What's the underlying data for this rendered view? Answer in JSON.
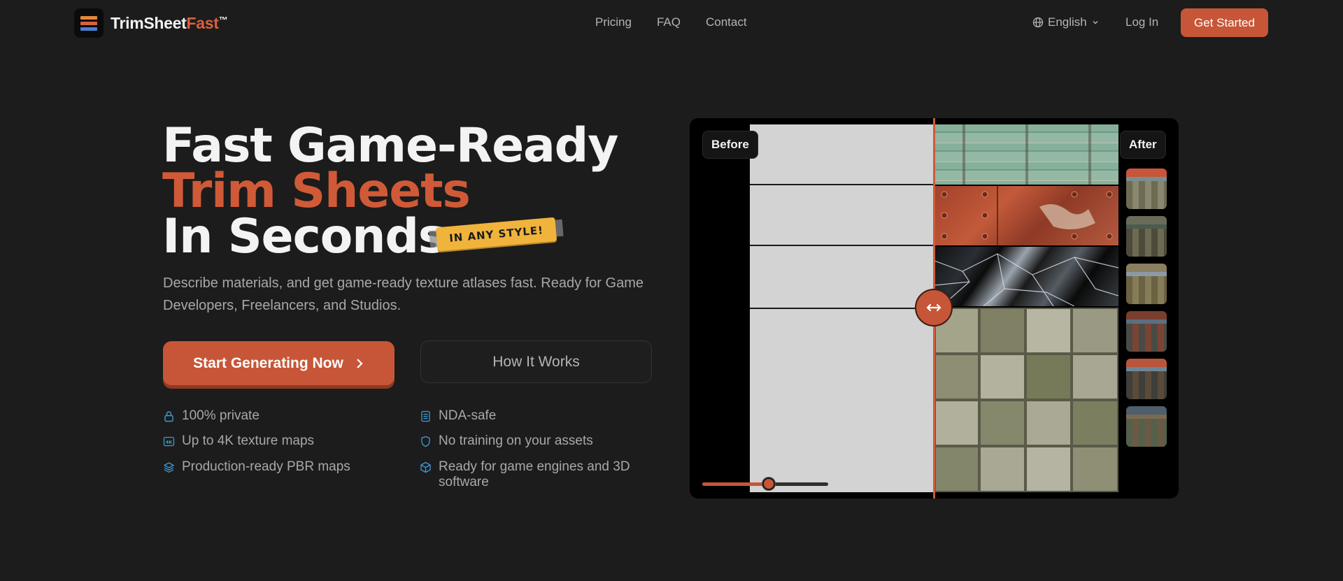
{
  "brand": {
    "name_main": "TrimSheet",
    "name_accent": "Fast",
    "trademark": "™",
    "logo_colors": [
      "#e5883c",
      "#d9603b",
      "#4a7fd0"
    ]
  },
  "nav": {
    "links": [
      "Pricing",
      "FAQ",
      "Contact"
    ],
    "language": "English",
    "login": "Log In",
    "cta": "Get Started"
  },
  "hero": {
    "title_line1": "Fast Game-Ready",
    "title_line2": "Trim Sheets",
    "title_line3": "In Seconds",
    "tag": "IN ANY STYLE!",
    "subtitle": "Describe materials, and get game-ready texture atlases fast. Ready for Game Developers, Freelancers, and Studios.",
    "primary_button": "Start Generating Now",
    "secondary_button": "How It Works",
    "accent_color": "#c65637"
  },
  "features": {
    "left": [
      {
        "icon": "lock-icon",
        "text": "100% private"
      },
      {
        "icon": "4k-icon",
        "text": "Up to 4K texture maps"
      },
      {
        "icon": "layers-icon",
        "text": "Production-ready PBR maps"
      }
    ],
    "right": [
      {
        "icon": "document-icon",
        "text": "NDA-safe"
      },
      {
        "icon": "shield-icon",
        "text": "No training on your assets"
      },
      {
        "icon": "cube-icon",
        "text": "Ready for game engines and 3D software"
      }
    ]
  },
  "preview": {
    "before_label": "Before",
    "after_label": "After",
    "comparison_position": 0.5,
    "slider_value": 0.53,
    "materials": [
      "painted-wood",
      "rusted-metal",
      "broken-glass",
      "mossy-stone-tiles"
    ],
    "thumbnail_count": 6
  }
}
